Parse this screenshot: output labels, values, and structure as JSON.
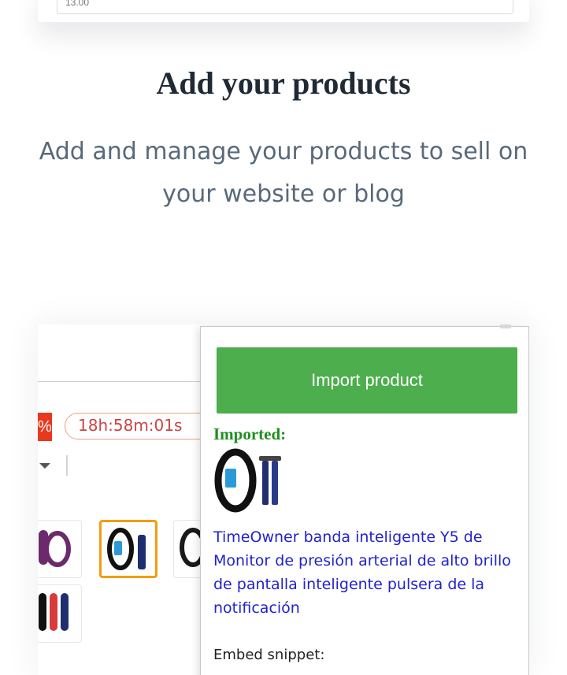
{
  "top_card": {
    "input_value": "13.00"
  },
  "feature": {
    "title": "Add your products",
    "description": "Add and manage your products to sell on your website or blog"
  },
  "store_page": {
    "discount_text": "%",
    "countdown": "18h:58m:01s",
    "thumbnail_colors": [
      "#6b2a6b",
      "#111111",
      "#1a1a1a",
      "#d93b3b"
    ]
  },
  "extension_popup": {
    "import_button": "Import product",
    "imported_label": "Imported:",
    "product_title": "TimeOwner banda inteligente Y5 de Monitor de presión arterial de alto brillo de pantalla inteligente pulsera de la notificación",
    "embed_label": "Embed snippet:"
  },
  "colors": {
    "import_button_bg": "#4cae4c",
    "imported_label": "#1e8e1e",
    "product_link": "#2222cc",
    "selected_thumbnail_border": "#f39c12"
  }
}
